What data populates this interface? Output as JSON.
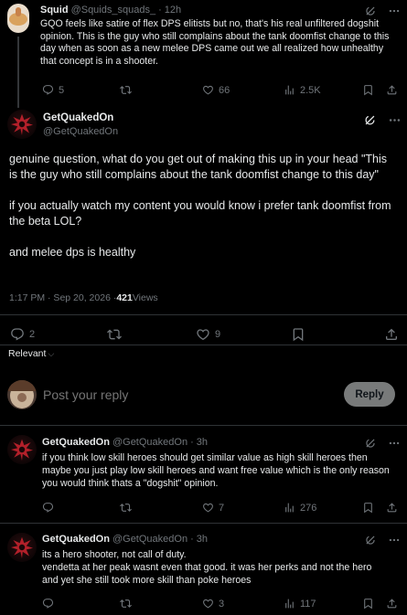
{
  "parent_tweet": {
    "name": "Squid",
    "handle": "@Squids_squads_",
    "dot": "·",
    "time": "12h",
    "text": "GQO feels like satire of flex DPS elitists but no, that's his real unfiltered dogshit opinion. This is the guy who still complains about the tank doomfist change to this day when as soon as a new melee DPS came out we all realized how unhealthy that concept is in a shooter.",
    "replies": "5",
    "retweets": "",
    "likes": "66",
    "views": "2.5K"
  },
  "main_tweet": {
    "name": "GetQuakedOn",
    "handle": "@GetQuakedOn",
    "paragraph1": "genuine question, what do you get out of making this up in your head \"This is the guy who still complains about the tank doomfist change to this day\"",
    "paragraph2": "if you actually watch my content you would know i prefer tank doomfist from the beta LOL?",
    "paragraph3": "and melee dps is healthy",
    "timestamp": "1:17 PM · Sep 20, 2026 · ",
    "view_count": "421",
    "views_label": " Views",
    "replies": "2",
    "retweets": "",
    "likes": "9"
  },
  "sort": {
    "label": "Relevant",
    "chevron": "⌵"
  },
  "compose": {
    "placeholder": "Post your reply",
    "button": "Reply"
  },
  "reply1": {
    "name": "GetQuakedOn",
    "handle": "@GetQuakedOn",
    "dot": "·",
    "time": "3h",
    "text": "if you think low skill heroes should get similar value as high skill heroes then maybe you just play low skill heroes and want free value which is the only reason you would think thats a \"dogshit\" opinion.",
    "replies": "",
    "retweets": "",
    "likes": "7",
    "views": "276"
  },
  "reply2": {
    "name": "GetQuakedOn",
    "handle": "@GetQuakedOn",
    "dot": "·",
    "time": "3h",
    "text_line1": "its a hero shooter, not call of duty.",
    "text_line2": "vendetta at her peak wasnt even that good. it was her perks and not the hero and yet she still took more  skill than poke heroes",
    "replies": "",
    "retweets": "",
    "likes": "3",
    "views": "117"
  },
  "icons": {
    "reply": "speech-bubble-icon",
    "retweet": "retweet-icon",
    "like": "heart-icon",
    "views": "bar-chart-icon",
    "bookmark": "bookmark-icon",
    "share": "share-icon",
    "grok": "grok-icon",
    "more": "more-icon"
  },
  "colors": {
    "background": "#000000",
    "text": "#e7e9ea",
    "muted": "#71767b",
    "divider": "#2f3336",
    "reply_button_bg": "#787a7a"
  }
}
